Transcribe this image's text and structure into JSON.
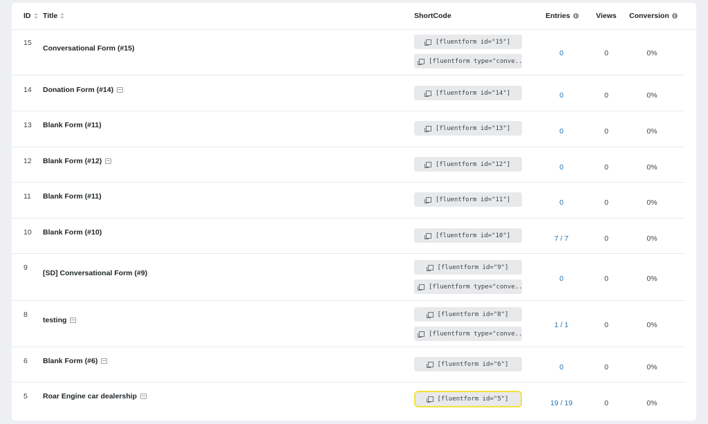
{
  "headers": {
    "id": "ID",
    "title": "Title",
    "shortcode": "ShortCode",
    "entries": "Entries",
    "views": "Views",
    "conversion": "Conversion"
  },
  "rows": [
    {
      "id": "15",
      "title": "Conversational Form (#15)",
      "edit": false,
      "shortcodes": [
        "[fluentform id=\"15\"]",
        "[fluentform type=\"conve..."
      ],
      "entries": "0",
      "views": "0",
      "conversion": "0%"
    },
    {
      "id": "14",
      "title": "Donation Form (#14)",
      "edit": true,
      "shortcodes": [
        "[fluentform id=\"14\"]"
      ],
      "entries": "0",
      "views": "0",
      "conversion": "0%"
    },
    {
      "id": "13",
      "title": "Blank Form (#11)",
      "edit": false,
      "shortcodes": [
        "[fluentform id=\"13\"]"
      ],
      "entries": "0",
      "views": "0",
      "conversion": "0%"
    },
    {
      "id": "12",
      "title": "Blank Form (#12)",
      "edit": true,
      "shortcodes": [
        "[fluentform id=\"12\"]"
      ],
      "entries": "0",
      "views": "0",
      "conversion": "0%"
    },
    {
      "id": "11",
      "title": "Blank Form (#11)",
      "edit": false,
      "shortcodes": [
        "[fluentform id=\"11\"]"
      ],
      "entries": "0",
      "views": "0",
      "conversion": "0%"
    },
    {
      "id": "10",
      "title": "Blank Form (#10)",
      "edit": false,
      "shortcodes": [
        "[fluentform id=\"10\"]"
      ],
      "entries": "7 / 7",
      "views": "0",
      "conversion": "0%"
    },
    {
      "id": "9",
      "title": "[SD] Conversational Form (#9)",
      "edit": false,
      "shortcodes": [
        "[fluentform id=\"9\"]",
        "[fluentform type=\"conve..."
      ],
      "entries": "0",
      "views": "0",
      "conversion": "0%"
    },
    {
      "id": "8",
      "title": "testing",
      "edit": true,
      "shortcodes": [
        "[fluentform id=\"8\"]",
        "[fluentform type=\"conve..."
      ],
      "entries": "1 / 1",
      "views": "0",
      "conversion": "0%"
    },
    {
      "id": "6",
      "title": "Blank Form (#6)",
      "edit": true,
      "shortcodes": [
        "[fluentform id=\"6\"]"
      ],
      "entries": "0",
      "views": "0",
      "conversion": "0%"
    },
    {
      "id": "5",
      "title": "Roar Engine car dealership",
      "edit": true,
      "shortcodes": [
        "[fluentform id=\"5\"]"
      ],
      "entries": "19 / 19",
      "views": "0",
      "conversion": "0%",
      "highlight": true
    }
  ]
}
